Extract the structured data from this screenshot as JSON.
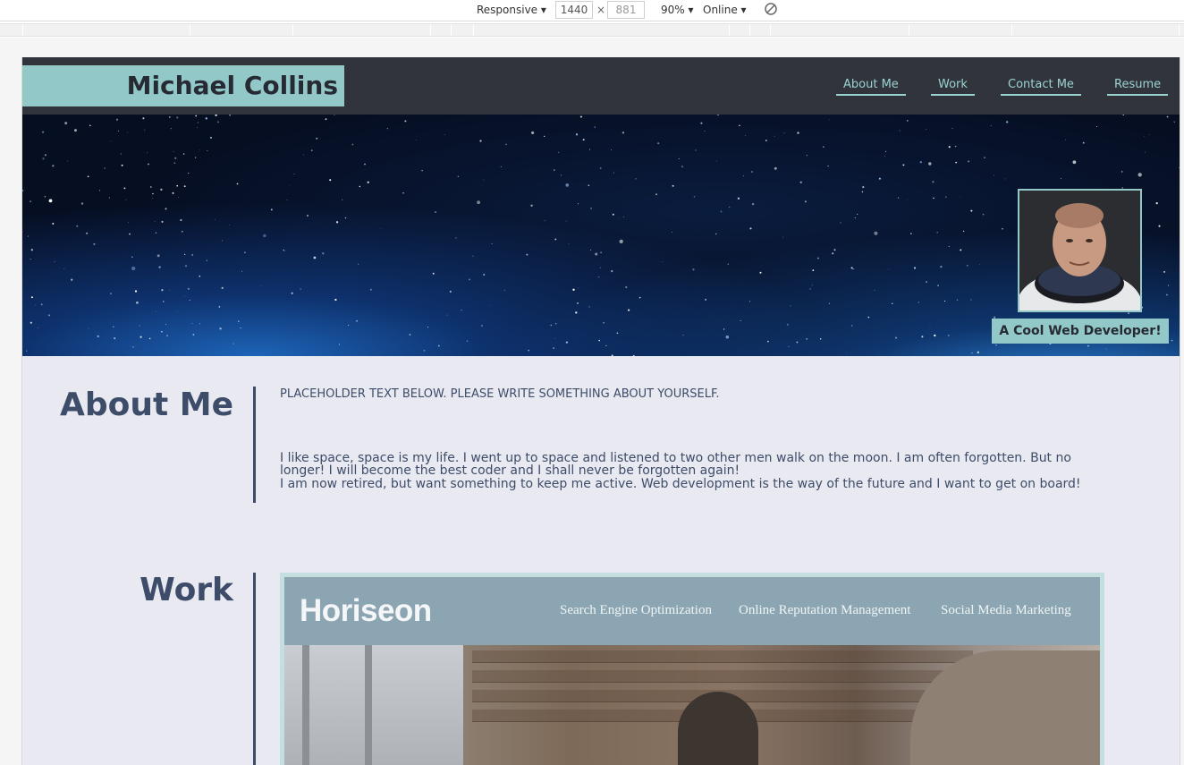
{
  "devtools": {
    "device_mode": "Responsive",
    "width": "1440",
    "height": "881",
    "times": "×",
    "zoom": "90%",
    "throttle": "Online"
  },
  "site": {
    "brand": "Michael Collins",
    "nav": [
      "About Me",
      "Work",
      "Contact Me",
      "Resume"
    ],
    "tagline": "A Cool Web Developer!",
    "about": {
      "title": "About Me",
      "placeholder_note": "PLACEHOLDER TEXT BELOW. PLEASE WRITE SOMETHING ABOUT YOURSELF.",
      "paragraph1": "I like space, space is my life. I went up to space and listened to two other men walk on the moon. I am often forgotten. But no longer! I will become the best coder and I shall never be forgotten again!",
      "paragraph2": "I am now retired, but want something to keep me active. Web development is the way of the future and I want to get on board!"
    },
    "work": {
      "title": "Work",
      "project": {
        "logo": "Horiseon",
        "links": [
          "Search Engine Optimization",
          "Online Reputation Management",
          "Social Media Marketing"
        ]
      }
    }
  }
}
